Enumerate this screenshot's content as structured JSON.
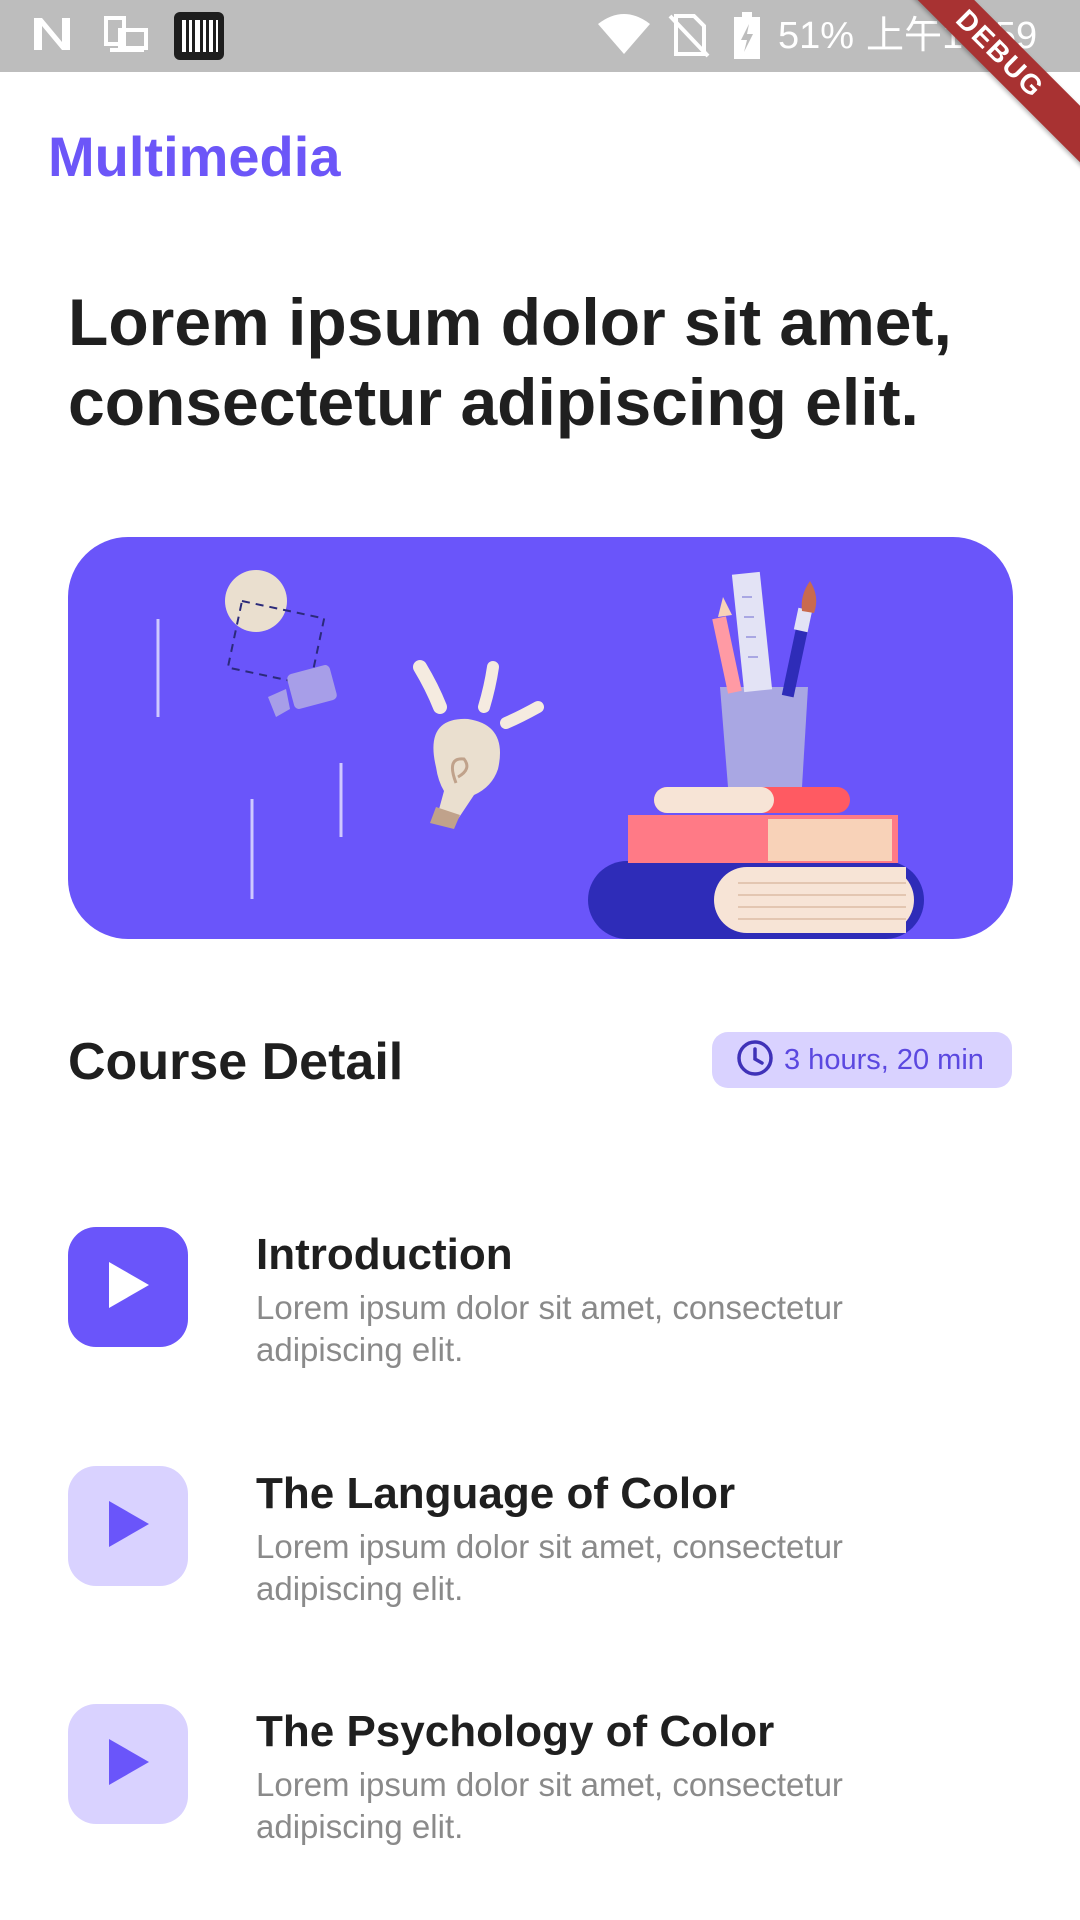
{
  "status_bar": {
    "battery_text": "51%",
    "time_text": "上午10:59",
    "icons": [
      "n-logo-icon",
      "screen-cast-icon",
      "barcode-icon",
      "wifi-icon",
      "no-sim-icon",
      "battery-icon"
    ]
  },
  "debug_banner": "DEBUG",
  "app": {
    "title": "Multimedia"
  },
  "headline": "Lorem ipsum dolor sit amet, consectetur adipiscing elit.",
  "course": {
    "section_title": "Course Detail",
    "duration": "3 hours, 20 min"
  },
  "lessons": [
    {
      "title": "Introduction",
      "description": "Lorem ipsum dolor sit amet, consectetur adipiscing elit."
    },
    {
      "title": "The Language of Color",
      "description": "Lorem ipsum dolor sit amet, consectetur adipiscing elit."
    },
    {
      "title": "The Psychology of Color",
      "description": "Lorem ipsum dolor sit amet, consectetur adipiscing elit."
    }
  ],
  "colors": {
    "accent": "#6a55fa",
    "accent_light": "#d9d2ff",
    "title_text": "#1f1f1f",
    "muted_text": "#8a8a8a",
    "status_bar": "#bdbdbd"
  }
}
